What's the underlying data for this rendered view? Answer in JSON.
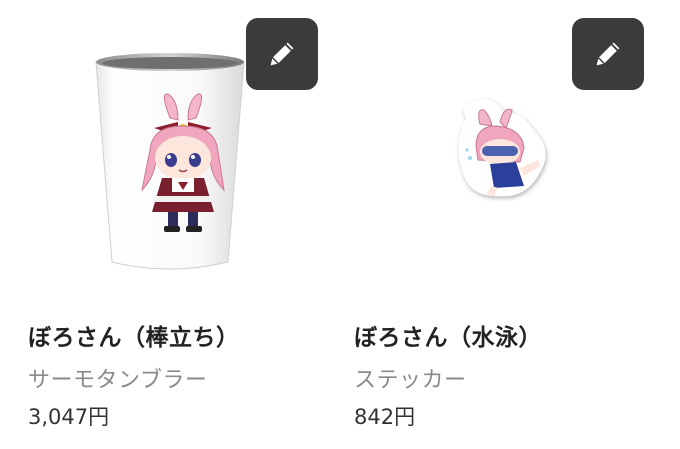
{
  "products": [
    {
      "title": "ぼろさん（棒立ち）",
      "category": "サーモタンブラー",
      "price": "3,047円",
      "edit_icon": "pencil-icon",
      "image": "thermo-tumbler-with-character-print"
    },
    {
      "title": "ぼろさん（水泳）",
      "category": "ステッカー",
      "price": "842円",
      "edit_icon": "pencil-icon",
      "image": "die-cut-sticker-with-swimming-character"
    }
  ],
  "colors": {
    "edit_button_bg": "#3b3b3b",
    "edit_icon": "#ffffff",
    "title": "#222222",
    "category": "#8a8a8a",
    "price": "#333333"
  }
}
